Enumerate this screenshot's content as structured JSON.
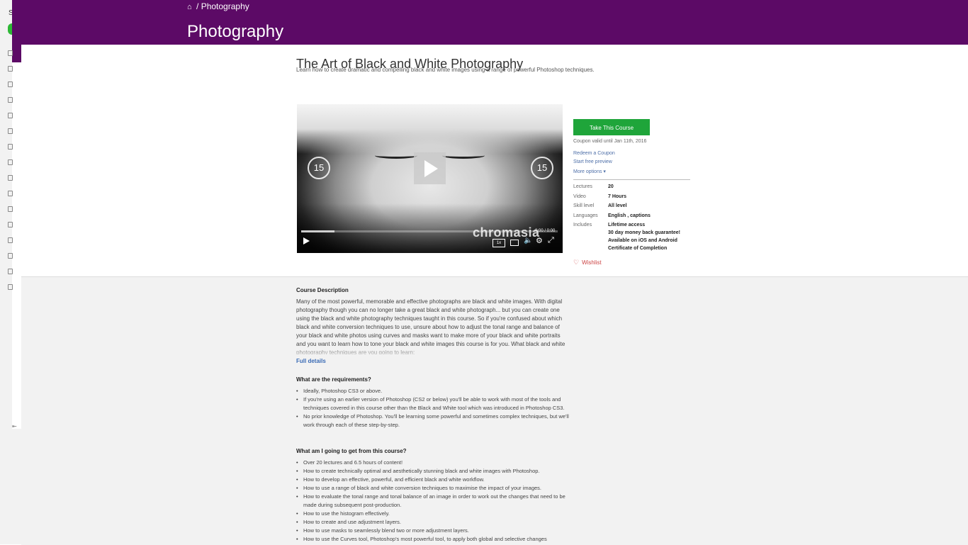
{
  "header": {
    "breadcrumb_sep": "/",
    "breadcrumb": "Photography",
    "title": "Photography"
  },
  "sidebar": {
    "letter": "S"
  },
  "course": {
    "title": "The Art of Black and White Photography",
    "subtitle": "Learn how to create dramatic and compelling black and white images using a range of powerful Photoshop techniques."
  },
  "video": {
    "skip_back": "15",
    "skip_forward": "15",
    "watermark": "chromasia",
    "time": "0:00 / 0:00",
    "speed": "1x",
    "progress_fraction": 0.13
  },
  "purchase": {
    "button": "Take This Course",
    "coupon_valid": "Coupon valid until Jan 11th, 2016",
    "redeem": "Redeem a Coupon",
    "preview": "Start free preview",
    "more": "More options ▾",
    "wishlist": "Wishlist"
  },
  "info": {
    "lectures_k": "Lectures",
    "lectures_v": "20",
    "video_k": "Video",
    "video_v": "7 Hours",
    "skill_k": "Skill level",
    "skill_v": "All level",
    "lang_k": "Languages",
    "lang_v": "English , captions",
    "inc_k": "Includes",
    "inc_1": "Lifetime access",
    "inc_2": "30 day money back guarantee!",
    "inc_3": "Available on iOS and Android",
    "inc_4": "Certificate of Completion"
  },
  "description": {
    "heading": "Course Description",
    "text": "Many of the most powerful, memorable and effective photographs are black and white images. With digital photography though you can no longer take a great black and white photograph... but you can create one using the black and white photography techniques taught in this course. So if you're confused about which black and white conversion techniques to use, unsure about how to adjust the tonal range and balance of your black and white photos using curves and masks want to make more of your black and white portraits and you want to learn how to tone your black and white images this course is for you. What black and white photography techniques are you going to learn:",
    "full_details": "Full details"
  },
  "requirements": {
    "heading": "What are the requirements?",
    "items": [
      "Ideally, Photoshop CS3 or above.",
      "If you're using an earlier version of Photoshop (CS2 or below) you'll be able to work with most of the tools and techniques covered in this course other than the Black and White tool which was introduced in Photoshop CS3.",
      "No prior knowledge of Photoshop. You'll be learning some powerful and sometimes complex techniques, but we'll work through each of these step-by-step."
    ]
  },
  "outcomes": {
    "heading": "What am I going to get from this course?",
    "items": [
      "Over 20 lectures and 6.5 hours of content!",
      "How to create technically optimal and aesthetically stunning black and white images with Photoshop.",
      "How to develop an effective, powerful, and efficient black and white workflow.",
      "How to use a range of black and white conversion techniques to maximise the impact of your images.",
      "How to evaluate the tonal range and tonal balance of an image in order to work out the changes that need to be made during subsequent post-production.",
      "How to use the histogram effectively.",
      "How to create and use adjustment layers.",
      "How to use masks to seamlessly blend two or more adjustment layers.",
      "How to use the Curves tool, Photoshop's most powerful tool, to apply both global and selective changes"
    ]
  }
}
